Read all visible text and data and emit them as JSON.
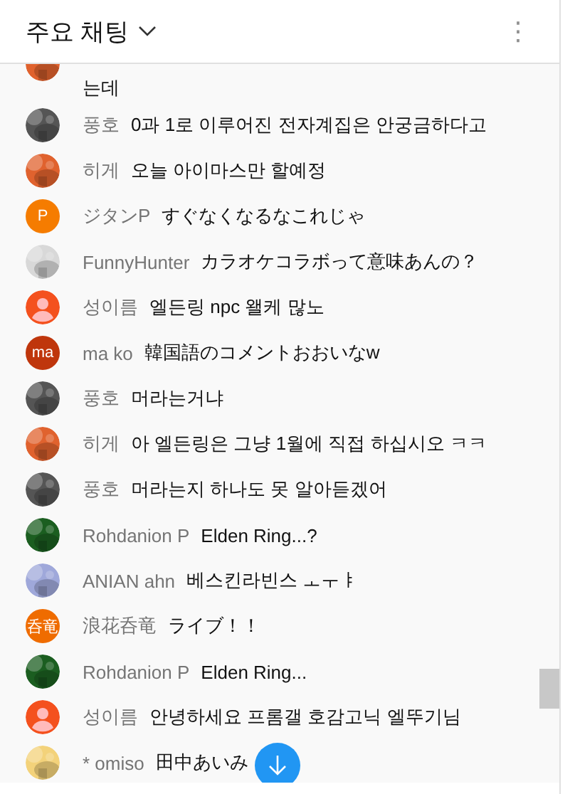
{
  "header": {
    "title": "주요 채팅",
    "menu_icon": "⋮"
  },
  "messages": [
    {
      "kind": "partial",
      "text": "는데"
    },
    {
      "kind": "full",
      "author": "풍호",
      "text": "0과 1로 이루어진 전자계집은 안궁금하다고"
    },
    {
      "kind": "full",
      "author": "히게",
      "text": "오늘 아이마스만 할예정"
    },
    {
      "kind": "full",
      "author": "ジタンP",
      "avatar": {
        "kind": "letter",
        "letter": "P",
        "color": "#f57c00"
      },
      "text": "すぐなくなるなこれじゃ"
    },
    {
      "kind": "full",
      "author": "FunnyHunter",
      "text": "カラオケコラボって意味あんの？"
    },
    {
      "kind": "full",
      "author": "성이름",
      "avatar": {
        "kind": "silhouette",
        "color": "#f4511e"
      },
      "text": "엘든링 npc 왤케 많노"
    },
    {
      "kind": "full",
      "author": "ma ko",
      "avatar": {
        "kind": "letter",
        "letter": "ma",
        "color": "#bf360c"
      },
      "text": "韓国語のコメントおおいなw"
    },
    {
      "kind": "full",
      "author": "풍호",
      "text": "머라는거냐"
    },
    {
      "kind": "full",
      "author": "히게",
      "text": "아 엘든링은 그냥 1월에 직접 하십시오 ㅋㅋ"
    },
    {
      "kind": "full",
      "author": "풍호",
      "text": "머라는지 하나도 못 알아듣겠어"
    },
    {
      "kind": "full",
      "author": "Rohdanion P",
      "text": "Elden Ring...?"
    },
    {
      "kind": "full",
      "author": "ANIAN ahn",
      "text": "베스킨라빈스 ㅗㅜㅑ"
    },
    {
      "kind": "full",
      "author": "浪花呑竜",
      "avatar": {
        "kind": "letter",
        "letter": "呑竜",
        "color": "#ef6c00"
      },
      "text": "ライブ！！"
    },
    {
      "kind": "full",
      "author": "Rohdanion P",
      "text": "Elden Ring..."
    },
    {
      "kind": "full",
      "author": "성이름",
      "avatar": {
        "kind": "silhouette",
        "color": "#f4511e"
      },
      "text": "안녕하세요 프롬갤 호감고닉 엘뚜기님"
    },
    {
      "kind": "full",
      "author": "* omiso",
      "text": "田中あいみ"
    }
  ]
}
